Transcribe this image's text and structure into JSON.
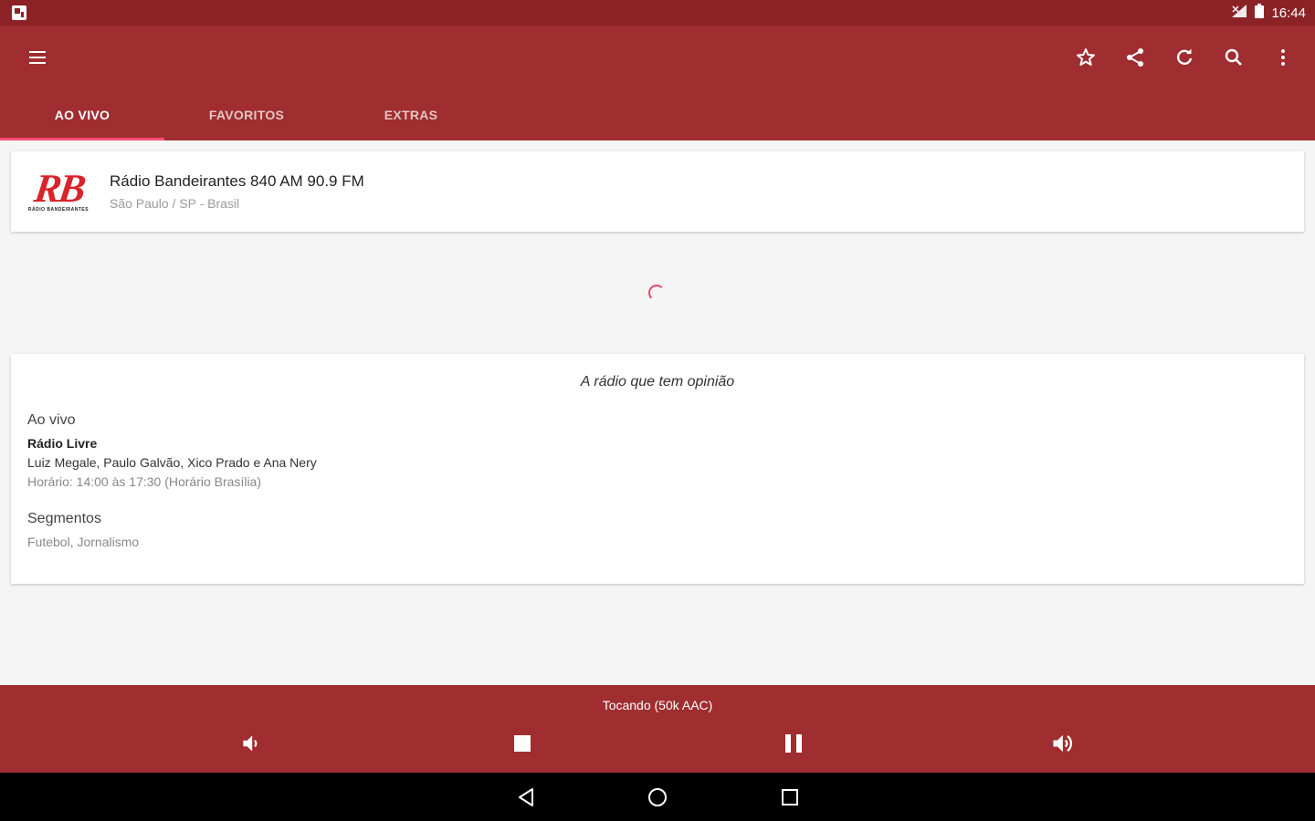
{
  "status_bar": {
    "time": "16:44"
  },
  "toolbar": {
    "menu_icon": "menu-icon",
    "actions": [
      "star-icon",
      "share-icon",
      "refresh-icon",
      "search-icon",
      "more-vert-icon"
    ]
  },
  "tabs": [
    {
      "label": "AO VIVO",
      "active": true
    },
    {
      "label": "FAVORITOS",
      "active": false
    },
    {
      "label": "EXTRAS",
      "active": false
    }
  ],
  "station": {
    "logo_text": "RB",
    "logo_sub": "RÁDIO BANDEIRANTES",
    "name": "Rádio Bandeirantes 840 AM 90.9 FM",
    "location": "São Paulo / SP - Brasil"
  },
  "info": {
    "slogan": "A rádio que tem opinião",
    "live_label": "Ao vivo",
    "program": "Rádio Livre",
    "hosts": "Luiz Megale, Paulo Galvão, Xico Prado e Ana Nery",
    "schedule": "Horário: 14:00 às 17:30  (Horário Brasília)",
    "segments_title": "Segmentos",
    "segments": "Futebol, Jornalismo"
  },
  "player": {
    "status": "Tocando (50k AAC)",
    "controls": [
      "volume-down-icon",
      "stop-icon",
      "pause-icon",
      "volume-up-icon"
    ]
  },
  "nav": [
    "back-icon",
    "home-icon",
    "recents-icon"
  ],
  "colors": {
    "primary": "#a02d30",
    "status_bar": "#8b2326",
    "tab_indicator": "#ff4f7a",
    "logo_red": "#d9232a"
  }
}
